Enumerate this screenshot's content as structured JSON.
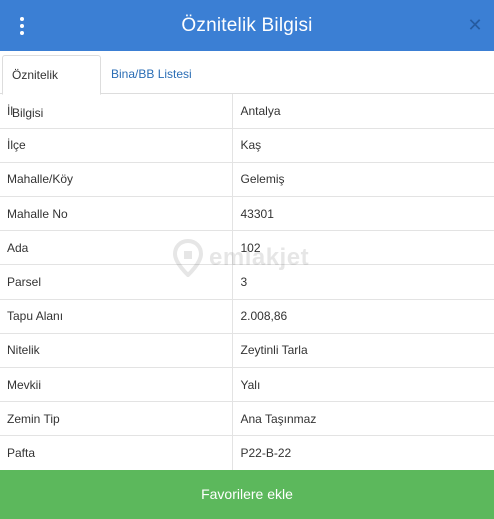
{
  "header": {
    "title": "Öznitelik Bilgisi",
    "close_label": "✕"
  },
  "tabs": [
    {
      "label": "Öznitelik Bilgisi",
      "active": true
    },
    {
      "label": "Bina/BB Listesi",
      "active": false
    }
  ],
  "attributes": [
    {
      "key": "İl",
      "value": "Antalya"
    },
    {
      "key": "İlçe",
      "value": "Kaş"
    },
    {
      "key": "Mahalle/Köy",
      "value": "Gelemiş"
    },
    {
      "key": "Mahalle No",
      "value": "43301"
    },
    {
      "key": "Ada",
      "value": "102"
    },
    {
      "key": "Parsel",
      "value": "3"
    },
    {
      "key": "Tapu Alanı",
      "value": "2.008,86"
    },
    {
      "key": "Nitelik",
      "value": "Zeytinli Tarla"
    },
    {
      "key": "Mevkii",
      "value": "Yalı"
    },
    {
      "key": "Zemin Tip",
      "value": "Ana Taşınmaz"
    },
    {
      "key": "Pafta",
      "value": "P22-B-22"
    }
  ],
  "watermark": {
    "text": "emlakjet"
  },
  "footer": {
    "favorite_label": "Favorilere ekle"
  },
  "colors": {
    "header_bg": "#3b7fd4",
    "tab_link": "#2a6db5",
    "favorite_bg": "#5cb85c"
  },
  "icons": {
    "menu": "vertical-dots-icon",
    "close": "close-icon",
    "watermark": "location-pin-icon"
  }
}
